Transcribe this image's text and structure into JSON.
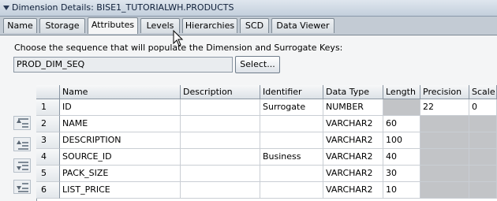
{
  "window": {
    "title": "Dimension Details: BISE1_TUTORIALWH.PRODUCTS"
  },
  "tabs": [
    "Name",
    "Storage",
    "Attributes",
    "Levels",
    "Hierarchies",
    "SCD",
    "Data Viewer"
  ],
  "active_tab": "Attributes",
  "sequence": {
    "prompt": "Choose the sequence that will populate the Dimension and Surrogate Keys:",
    "value": "PROD_DIM_SEQ",
    "select_label": "Select..."
  },
  "table": {
    "columns": [
      "Name",
      "Description",
      "Identifier",
      "Data Type",
      "Length",
      "Precision",
      "Scale"
    ],
    "rows": [
      {
        "num": "1",
        "name": "ID",
        "description": "",
        "identifier": "Surrogate",
        "data_type": "NUMBER",
        "length": "",
        "precision": "22",
        "scale": "0"
      },
      {
        "num": "2",
        "name": "NAME",
        "description": "",
        "identifier": "",
        "data_type": "VARCHAR2",
        "length": "60",
        "precision": "",
        "scale": ""
      },
      {
        "num": "3",
        "name": "DESCRIPTION",
        "description": "",
        "identifier": "",
        "data_type": "VARCHAR2",
        "length": "100",
        "precision": "",
        "scale": ""
      },
      {
        "num": "4",
        "name": "SOURCE_ID",
        "description": "",
        "identifier": "Business",
        "data_type": "VARCHAR2",
        "length": "40",
        "precision": "",
        "scale": ""
      },
      {
        "num": "5",
        "name": "PACK_SIZE",
        "description": "",
        "identifier": "",
        "data_type": "VARCHAR2",
        "length": "30",
        "precision": "",
        "scale": ""
      },
      {
        "num": "6",
        "name": "LIST_PRICE",
        "description": "",
        "identifier": "",
        "data_type": "VARCHAR2",
        "length": "10",
        "precision": "",
        "scale": ""
      }
    ]
  },
  "side_buttons": [
    "move-to-top-icon",
    "move-up-icon",
    "move-down-icon",
    "move-to-bottom-icon"
  ]
}
